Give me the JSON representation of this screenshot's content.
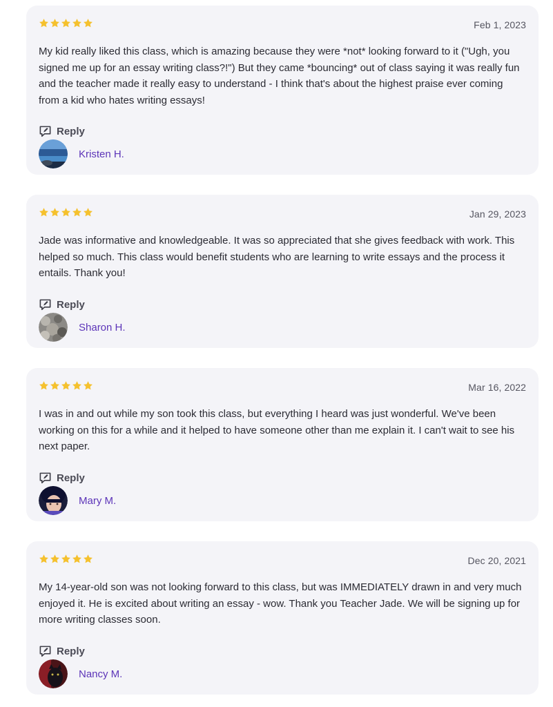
{
  "reviews": [
    {
      "rating": 5,
      "date": "Feb 1, 2023",
      "text": "My kid really liked this class, which is amazing because they were *not* looking forward to it (\"Ugh, you signed me up for an essay writing class?!\") But they came *bouncing* out of class saying it was really fun and the teacher made it really easy to understand - I think that's about the highest praise ever coming from a kid who hates writing essays!",
      "reply_label": "Reply",
      "author": "Kristen H."
    },
    {
      "rating": 5,
      "date": "Jan 29, 2023",
      "text": "Jade was informative and knowledgeable.  It was so appreciated that she gives feedback with work.  This helped so much.  This class would benefit students who are learning to write essays and the process it entails.  Thank you!",
      "reply_label": "Reply",
      "author": "Sharon H."
    },
    {
      "rating": 5,
      "date": "Mar 16, 2022",
      "text": "I was in and out while my son took this class, but everything I heard was just wonderful.  We've been working on this for a while and it helped to have someone other than me explain it.  I can't wait to see his next paper.",
      "reply_label": "Reply",
      "author": "Mary M."
    },
    {
      "rating": 5,
      "date": "Dec 20, 2021",
      "text": "My 14-year-old son was not looking forward to this class, but was IMMEDIATELY drawn in and very much enjoyed it.  He is excited about writing an essay - wow.  Thank you Teacher Jade.  We will be signing up for more writing classes soon.",
      "reply_label": "Reply",
      "author": "Nancy M."
    }
  ],
  "colors": {
    "card_background": "#f4f4f8",
    "star": "#f5c12e",
    "author_link": "#5c34b8",
    "text": "#2b2b33",
    "muted": "#555560"
  },
  "icons": {
    "star": "star-icon",
    "reply": "reply-speech-bubble-icon"
  }
}
